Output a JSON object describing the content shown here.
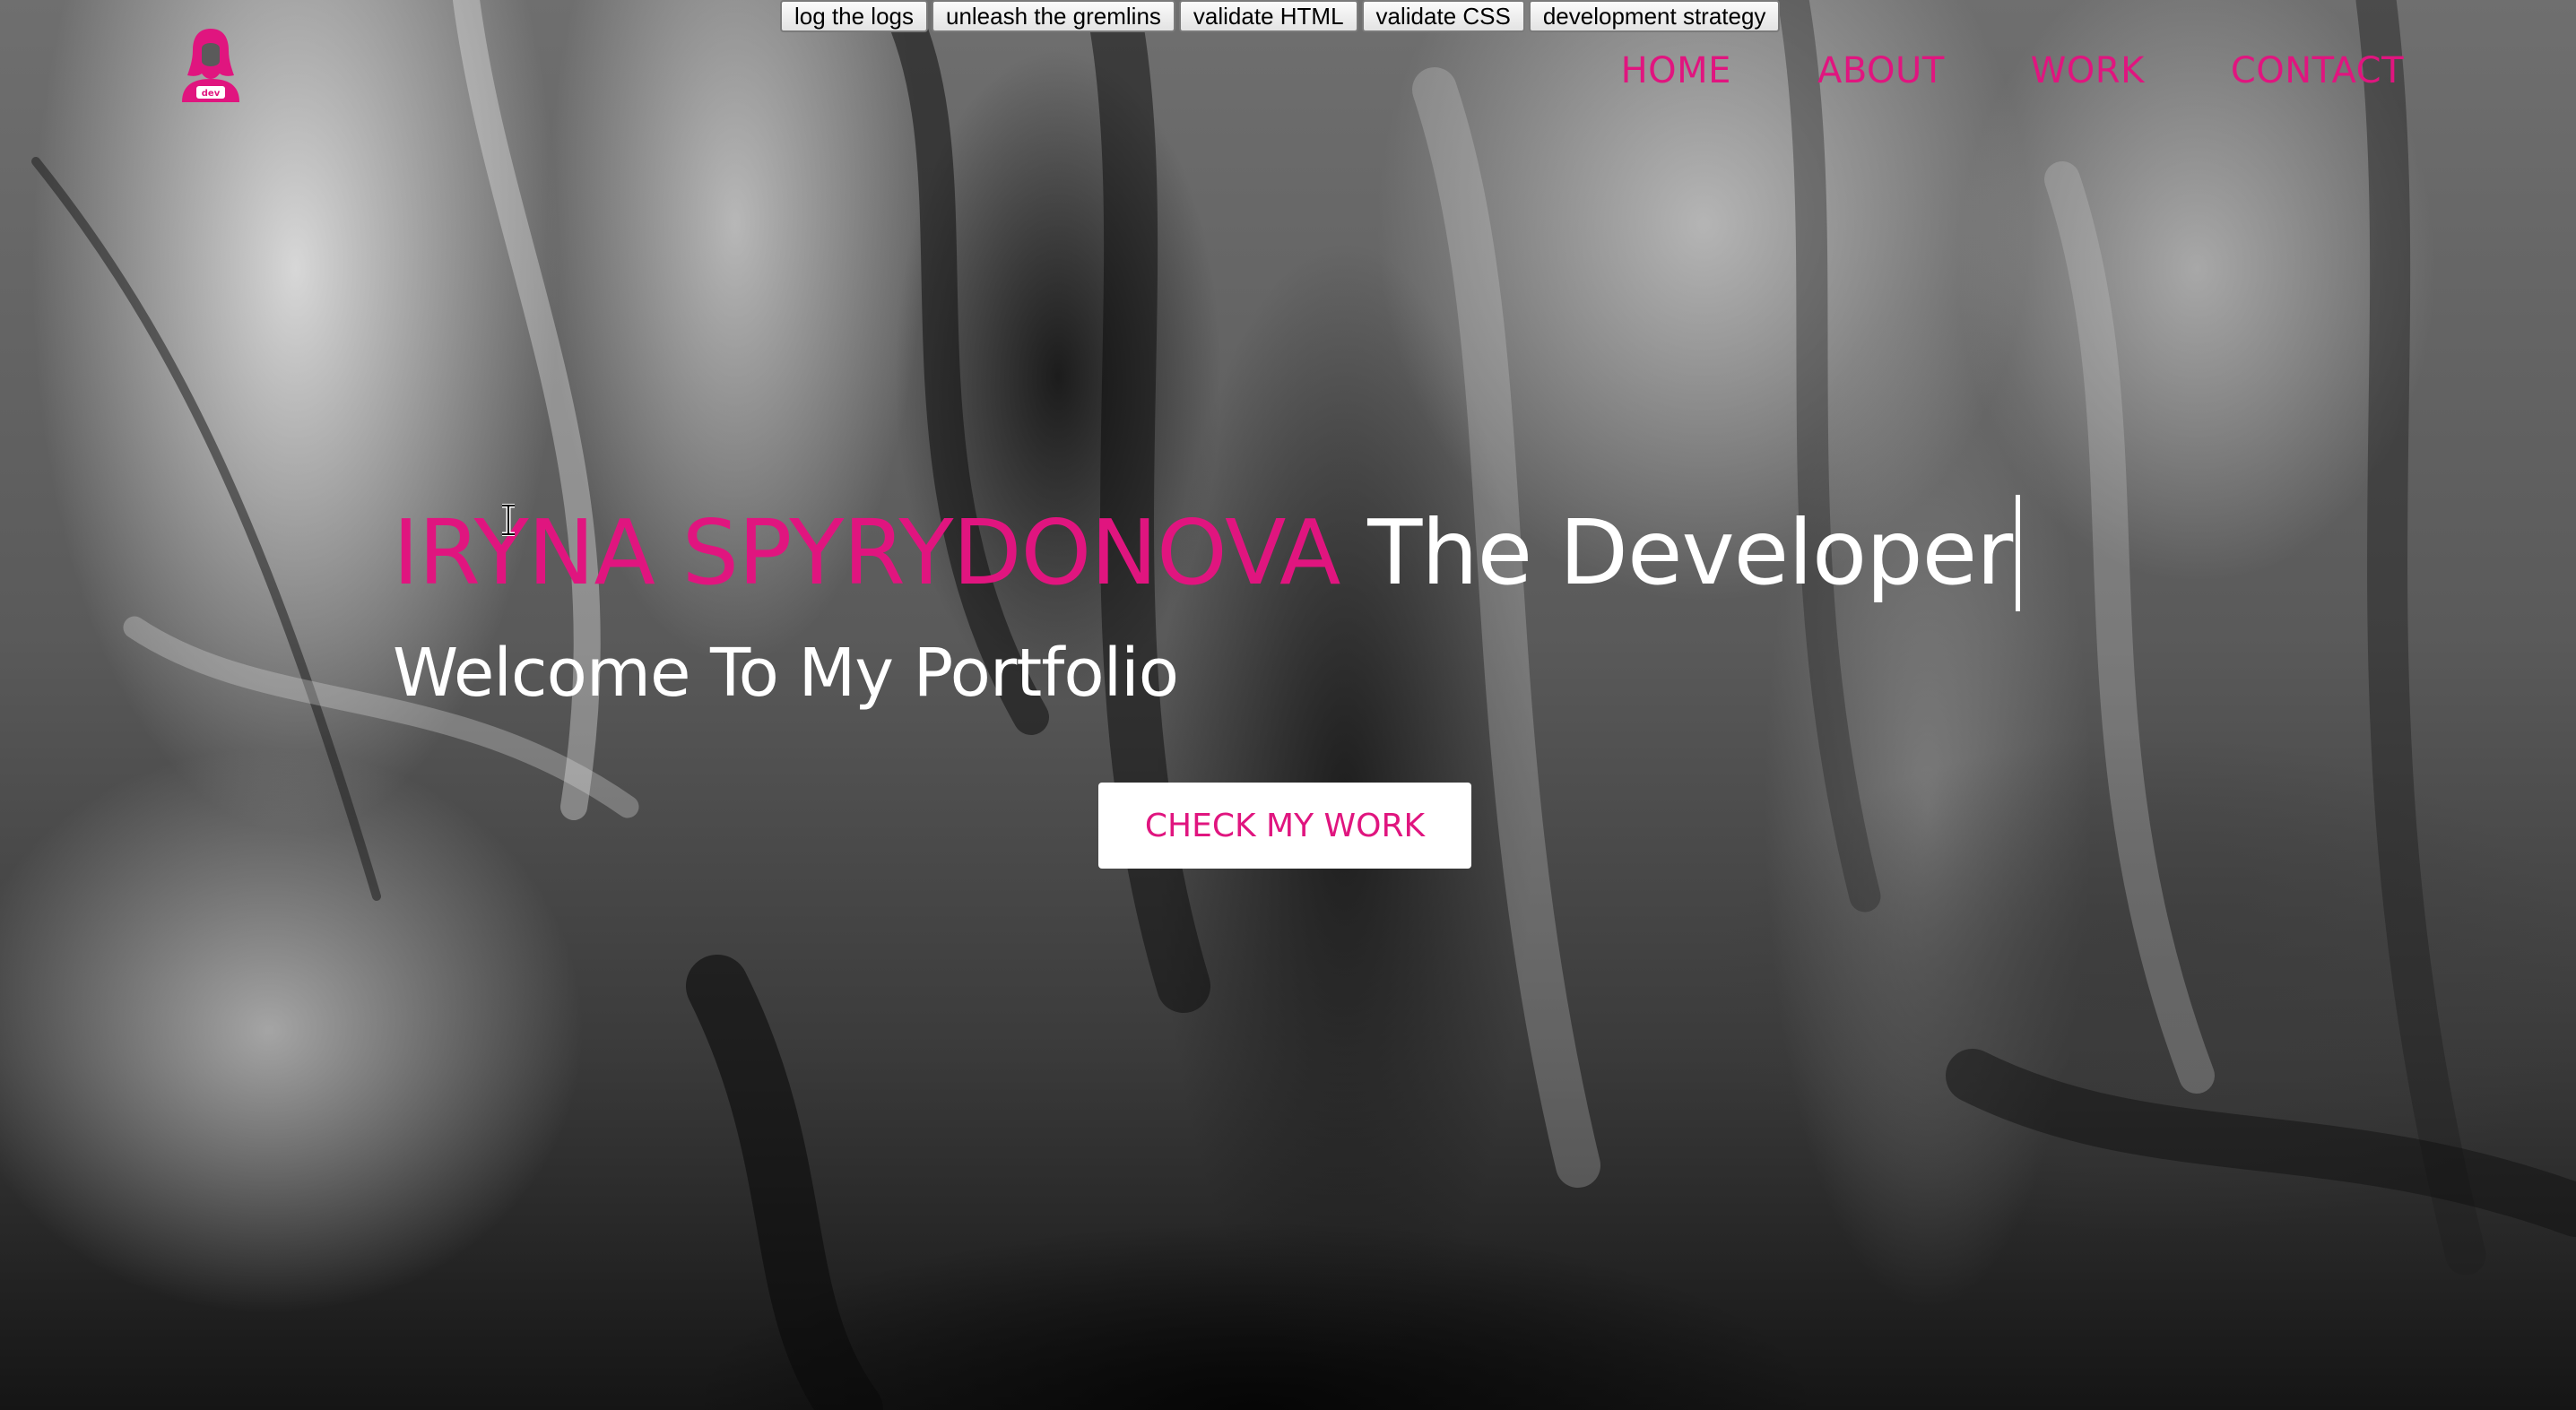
{
  "devtools": {
    "buttons": [
      "log the logs",
      "unleash the gremlins",
      "validate HTML",
      "validate CSS",
      "development strategy"
    ]
  },
  "logo": {
    "icon": "developer-woman-icon",
    "text": "dev",
    "color": "#e0157f"
  },
  "nav": {
    "items": [
      "HOME",
      "ABOUT",
      "WORK",
      "CONTACT"
    ]
  },
  "hero": {
    "name": "IRYNA SPYRYDONOVA",
    "role": "The Developer",
    "subtitle": "Welcome To My Portfolio",
    "cta_label": "CHECK MY WORK"
  },
  "colors": {
    "accent": "#e0157f",
    "text_light": "#ffffff"
  }
}
